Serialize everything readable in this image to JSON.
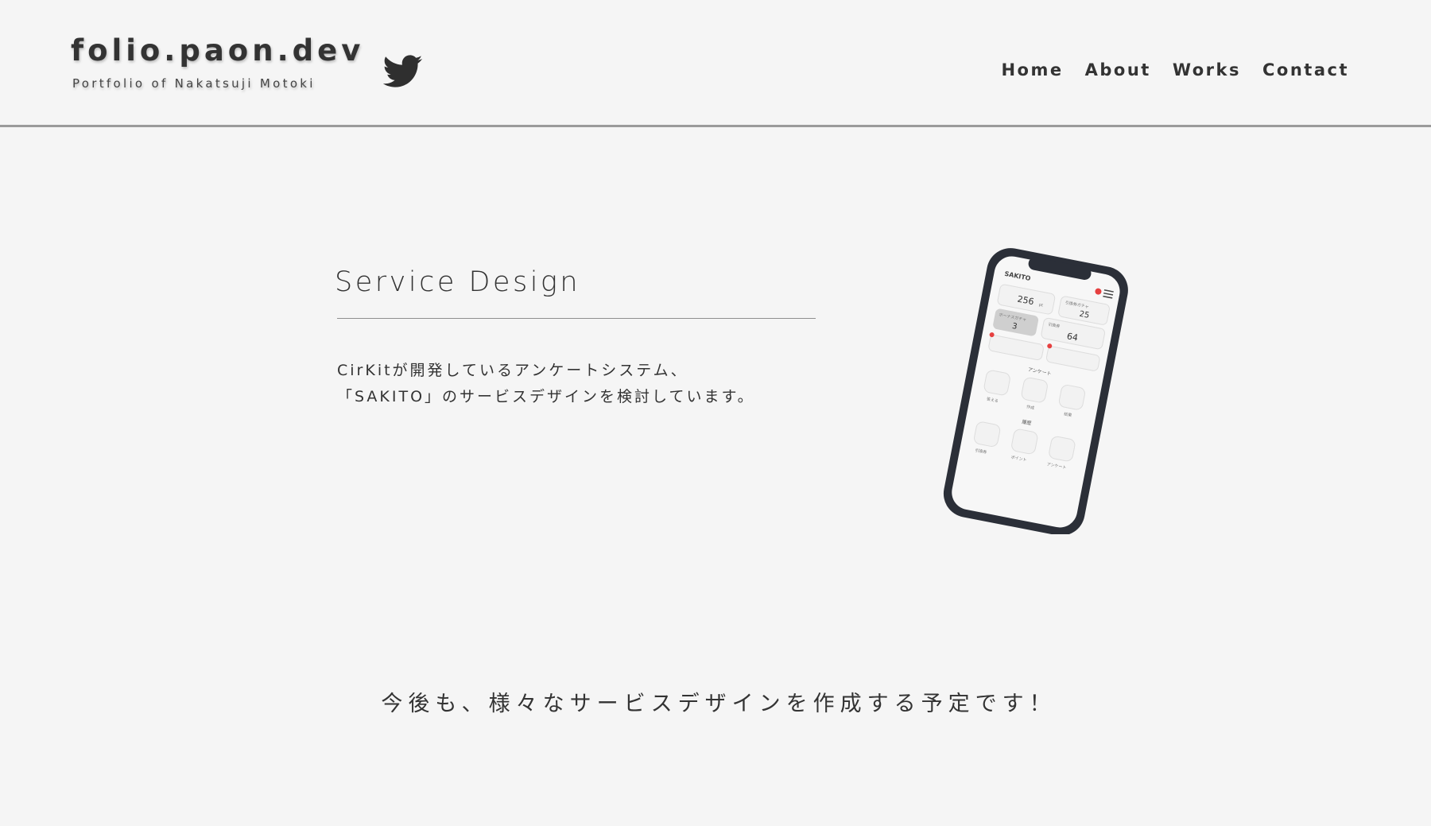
{
  "header": {
    "site_title": "folio.paon.dev",
    "site_subtitle": "Portfolio of Nakatsuji Motoki",
    "social_icon": "twitter-icon",
    "nav": [
      {
        "label": "Home"
      },
      {
        "label": "About"
      },
      {
        "label": "Works"
      },
      {
        "label": "Contact"
      }
    ]
  },
  "main": {
    "title": "Service Design",
    "description_lines": [
      "CirKitが開発しているアンケートシステム、",
      "「SAKITO」のサービスデザインを検討しています。"
    ],
    "phone": {
      "app_name": "SAKITO",
      "points_value": "256",
      "points_unit": "pt",
      "gacha_label": "引換券ガチャ",
      "gacha_value": "25",
      "bonus_label": "ボーナスガチャ",
      "bonus_value": "3",
      "ticket_label": "引換券",
      "ticket_value": "64",
      "section_enquete": "アンケート",
      "enquete_items": [
        "答える",
        "作成",
        "結果"
      ],
      "section_history": "履歴",
      "history_items": [
        "引換券",
        "ポイント",
        "アンケート"
      ]
    }
  },
  "footer": {
    "message": "今後も、様々なサービスデザインを作成する予定です！"
  },
  "colors": {
    "background": "#f5f5f5",
    "text": "#333333",
    "phone_frame": "#2b2f38"
  }
}
